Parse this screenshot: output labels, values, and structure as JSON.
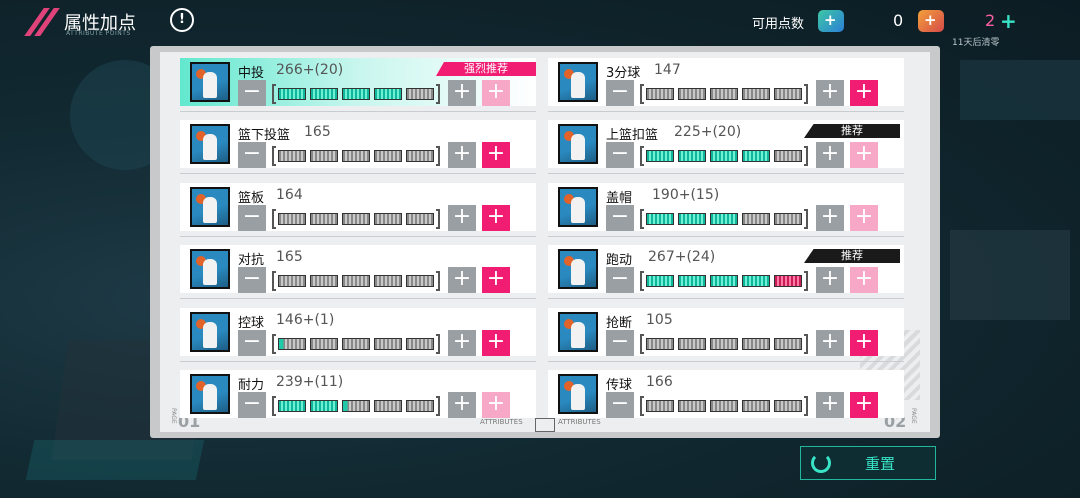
{
  "header": {
    "title": "属性加点",
    "subtitle": "ATTRIBUTE POINTS",
    "available_label": "可用点数",
    "available_value": "0",
    "token_value": "2",
    "reset_note": "11天后清零"
  },
  "panel": {
    "page_left": "01",
    "page_right": "02",
    "page_tag": "PAGE",
    "attr_left": "ATTRIBUTES",
    "attr_right": "ATTRIBUTES"
  },
  "left": [
    {
      "name": "中投",
      "value": "266+(20)",
      "segs": [
        "full",
        "full",
        "full",
        "full",
        "empty"
      ],
      "tag": "强烈推荐",
      "tag_type": "strong",
      "plus2": "light",
      "highlight": true
    },
    {
      "name": "篮下投篮",
      "value": "165",
      "segs": [
        "empty",
        "empty",
        "empty",
        "empty",
        "empty"
      ],
      "tag": "",
      "plus2": "pink"
    },
    {
      "name": "篮板",
      "value": "164",
      "segs": [
        "empty",
        "empty",
        "empty",
        "empty",
        "empty"
      ],
      "tag": "",
      "plus2": "pink"
    },
    {
      "name": "对抗",
      "value": "165",
      "segs": [
        "empty",
        "empty",
        "empty",
        "empty",
        "empty"
      ],
      "tag": "",
      "plus2": "pink"
    },
    {
      "name": "控球",
      "value": "146+(1)",
      "segs": [
        "partial",
        "empty",
        "empty",
        "empty",
        "empty"
      ],
      "tag": "",
      "plus2": "pink"
    },
    {
      "name": "耐力",
      "value": "239+(11)",
      "segs": [
        "full",
        "full",
        "partial",
        "empty",
        "empty"
      ],
      "tag": "",
      "plus2": "light"
    }
  ],
  "right": [
    {
      "name": "3分球",
      "value": "147",
      "segs": [
        "empty",
        "empty",
        "empty",
        "empty",
        "empty"
      ],
      "tag": "",
      "plus2": "pink"
    },
    {
      "name": "上篮扣篮",
      "value": "225+(20)",
      "segs": [
        "full",
        "full",
        "full",
        "full",
        "empty"
      ],
      "tag": "推荐",
      "tag_type": "rec",
      "plus2": "light"
    },
    {
      "name": "盖帽",
      "value": "190+(15)",
      "segs": [
        "full",
        "full",
        "full",
        "empty",
        "empty"
      ],
      "tag": "",
      "plus2": "light"
    },
    {
      "name": "跑动",
      "value": "267+(24)",
      "segs": [
        "full",
        "full",
        "full",
        "full",
        "red"
      ],
      "tag": "推荐",
      "tag_type": "rec",
      "plus2": "light"
    },
    {
      "name": "抢断",
      "value": "105",
      "segs": [
        "empty",
        "empty",
        "empty",
        "empty",
        "empty"
      ],
      "tag": "",
      "plus2": "pink"
    },
    {
      "name": "传球",
      "value": "166",
      "segs": [
        "empty",
        "empty",
        "empty",
        "empty",
        "empty"
      ],
      "tag": "",
      "plus2": "pink"
    }
  ],
  "buttons": {
    "minus": "−",
    "plus": "+",
    "reset_label": "重置"
  },
  "colors": {
    "accent_pink": "#f01d73",
    "accent_teal": "#39e3c6",
    "bar_full": "#0fb79a",
    "bar_red": "#c91e58"
  },
  "icons": [
    "back-chevron-icon",
    "info-icon",
    "points-token-icon",
    "gem-token-icon",
    "basketball-player-icon",
    "refresh-icon"
  ]
}
